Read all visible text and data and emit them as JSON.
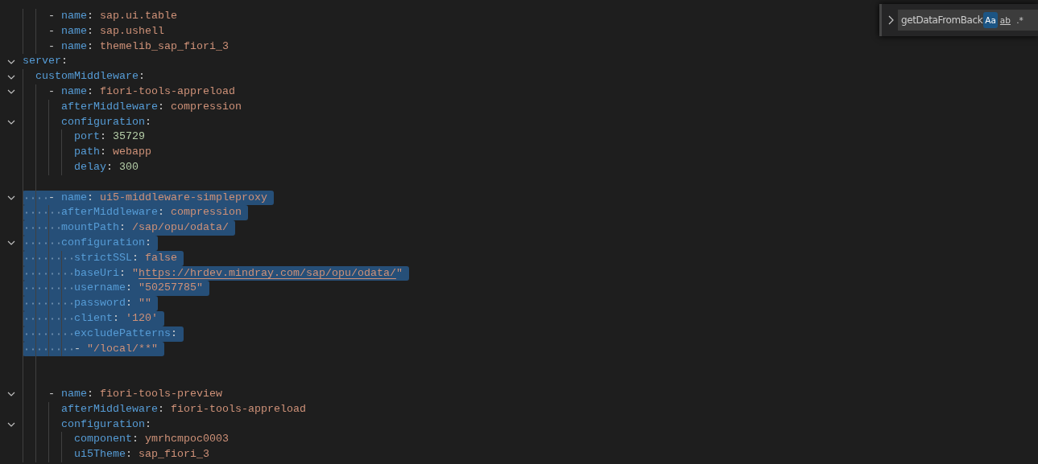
{
  "editor": {
    "lines": [
      {
        "children": [
          {
            "children": [
              {
                "tokens": [
                  {
                    "kind": "dash",
                    "text": "- "
                  },
                  {
                    "kind": "key",
                    "text": "name"
                  },
                  {
                    "kind": "punct",
                    "text": ": "
                  },
                  {
                    "kind": "string",
                    "text": "sap.ui.table"
                  }
                ],
                "foldable": false,
                "selected": false
              },
              {
                "tokens": [
                  {
                    "kind": "dash",
                    "text": "- "
                  },
                  {
                    "kind": "key",
                    "text": "name"
                  },
                  {
                    "kind": "punct",
                    "text": ": "
                  },
                  {
                    "kind": "string",
                    "text": "sap.ushell"
                  }
                ],
                "foldable": false,
                "selected": false
              },
              {
                "tokens": [
                  {
                    "kind": "dash",
                    "text": "- "
                  },
                  {
                    "kind": "key",
                    "text": "name"
                  },
                  {
                    "kind": "punct",
                    "text": ": "
                  },
                  {
                    "kind": "string",
                    "text": "themelib_sap_fiori_3"
                  }
                ],
                "foldable": false,
                "selected": false
              }
            ]
          }
        ]
      },
      {
        "tokens": [
          {
            "kind": "key",
            "text": "server"
          },
          {
            "kind": "punct",
            "text": ":"
          }
        ],
        "foldable": true,
        "selected": false,
        "children": [
          {
            "tokens": [
              {
                "kind": "key",
                "text": "customMiddleware"
              },
              {
                "kind": "punct",
                "text": ":"
              }
            ],
            "foldable": true,
            "selected": false,
            "children": [
              {
                "tokens": [
                  {
                    "kind": "dash",
                    "text": "- "
                  },
                  {
                    "kind": "key",
                    "text": "name"
                  },
                  {
                    "kind": "punct",
                    "text": ": "
                  },
                  {
                    "kind": "string",
                    "text": "fiori-tools-appreload"
                  }
                ],
                "foldable": true,
                "selected": false,
                "children": [
                  {
                    "tokens": [
                      {
                        "kind": "key",
                        "text": "afterMiddleware"
                      },
                      {
                        "kind": "punct",
                        "text": ": "
                      },
                      {
                        "kind": "string",
                        "text": "compression"
                      }
                    ],
                    "foldable": false,
                    "selected": false
                  },
                  {
                    "tokens": [
                      {
                        "kind": "key",
                        "text": "configuration"
                      },
                      {
                        "kind": "punct",
                        "text": ":"
                      }
                    ],
                    "foldable": true,
                    "selected": false,
                    "children": [
                      {
                        "tokens": [
                          {
                            "kind": "key",
                            "text": "port"
                          },
                          {
                            "kind": "punct",
                            "text": ": "
                          },
                          {
                            "kind": "number",
                            "text": "35729"
                          }
                        ],
                        "foldable": false,
                        "selected": false
                      },
                      {
                        "tokens": [
                          {
                            "kind": "key",
                            "text": "path"
                          },
                          {
                            "kind": "punct",
                            "text": ": "
                          },
                          {
                            "kind": "string",
                            "text": "webapp"
                          }
                        ],
                        "foldable": false,
                        "selected": false
                      },
                      {
                        "tokens": [
                          {
                            "kind": "key",
                            "text": "delay"
                          },
                          {
                            "kind": "punct",
                            "text": ": "
                          },
                          {
                            "kind": "number",
                            "text": "300"
                          }
                        ],
                        "foldable": false,
                        "selected": false
                      }
                    ]
                  }
                ]
              },
              {
                "kind": "blank",
                "selected": false
              },
              {
                "tokens": [
                  {
                    "kind": "dash",
                    "text": "- "
                  },
                  {
                    "kind": "key",
                    "text": "name"
                  },
                  {
                    "kind": "punct",
                    "text": ": "
                  },
                  {
                    "kind": "string",
                    "text": "ui5-middleware-simpleproxy"
                  }
                ],
                "foldable": true,
                "selected": true,
                "children": [
                  {
                    "tokens": [
                      {
                        "kind": "key",
                        "text": "afterMiddleware"
                      },
                      {
                        "kind": "punct",
                        "text": ": "
                      },
                      {
                        "kind": "string",
                        "text": "compression"
                      }
                    ],
                    "foldable": false,
                    "selected": true
                  },
                  {
                    "tokens": [
                      {
                        "kind": "key",
                        "text": "mountPath"
                      },
                      {
                        "kind": "punct",
                        "text": ": "
                      },
                      {
                        "kind": "string",
                        "text": "/sap/opu/odata/"
                      }
                    ],
                    "foldable": false,
                    "selected": true
                  },
                  {
                    "tokens": [
                      {
                        "kind": "key",
                        "text": "configuration"
                      },
                      {
                        "kind": "punct",
                        "text": ":"
                      }
                    ],
                    "foldable": true,
                    "selected": true,
                    "children": [
                      {
                        "tokens": [
                          {
                            "kind": "key",
                            "text": "strictSSL"
                          },
                          {
                            "kind": "punct",
                            "text": ": "
                          },
                          {
                            "kind": "string",
                            "text": "false"
                          }
                        ],
                        "foldable": false,
                        "selected": true
                      },
                      {
                        "tokens": [
                          {
                            "kind": "key",
                            "text": "baseUri"
                          },
                          {
                            "kind": "punct",
                            "text": ": "
                          },
                          {
                            "kind": "string",
                            "text": "\""
                          },
                          {
                            "kind": "link",
                            "text": "https://hrdev.mindray.com/sap/opu/odata/"
                          },
                          {
                            "kind": "string",
                            "text": "\""
                          }
                        ],
                        "foldable": false,
                        "selected": true
                      },
                      {
                        "tokens": [
                          {
                            "kind": "key",
                            "text": "username"
                          },
                          {
                            "kind": "punct",
                            "text": ": "
                          },
                          {
                            "kind": "string",
                            "text": "\"50257785\""
                          }
                        ],
                        "foldable": false,
                        "selected": true
                      },
                      {
                        "tokens": [
                          {
                            "kind": "key",
                            "text": "password"
                          },
                          {
                            "kind": "punct",
                            "text": ": "
                          },
                          {
                            "kind": "string",
                            "text": "\"\""
                          }
                        ],
                        "foldable": false,
                        "selected": true
                      },
                      {
                        "tokens": [
                          {
                            "kind": "key",
                            "text": "client"
                          },
                          {
                            "kind": "punct",
                            "text": ": "
                          },
                          {
                            "kind": "string",
                            "text": "'120'"
                          }
                        ],
                        "foldable": false,
                        "selected": true
                      },
                      {
                        "tokens": [
                          {
                            "kind": "key",
                            "text": "excludePatterns"
                          },
                          {
                            "kind": "punct",
                            "text": ":"
                          }
                        ],
                        "foldable": false,
                        "selected": true
                      },
                      {
                        "tokens": [
                          {
                            "kind": "dash",
                            "text": "- "
                          },
                          {
                            "kind": "string",
                            "text": "\"/local/**\""
                          }
                        ],
                        "foldable": false,
                        "selected": true
                      }
                    ]
                  }
                ]
              },
              {
                "kind": "blank",
                "selected": false
              },
              {
                "kind": "blank",
                "selected": false
              },
              {
                "tokens": [
                  {
                    "kind": "dash",
                    "text": "- "
                  },
                  {
                    "kind": "key",
                    "text": "name"
                  },
                  {
                    "kind": "punct",
                    "text": ": "
                  },
                  {
                    "kind": "string",
                    "text": "fiori-tools-preview"
                  }
                ],
                "foldable": true,
                "selected": false,
                "children": [
                  {
                    "tokens": [
                      {
                        "kind": "key",
                        "text": "afterMiddleware"
                      },
                      {
                        "kind": "punct",
                        "text": ": "
                      },
                      {
                        "kind": "string",
                        "text": "fiori-tools-appreload"
                      }
                    ],
                    "foldable": false,
                    "selected": false
                  },
                  {
                    "tokens": [
                      {
                        "kind": "key",
                        "text": "configuration"
                      },
                      {
                        "kind": "punct",
                        "text": ":"
                      }
                    ],
                    "foldable": true,
                    "selected": false,
                    "children": [
                      {
                        "tokens": [
                          {
                            "kind": "key",
                            "text": "component"
                          },
                          {
                            "kind": "punct",
                            "text": ": "
                          },
                          {
                            "kind": "string",
                            "text": "ymrhcmpoc0003"
                          }
                        ],
                        "foldable": false,
                        "selected": false
                      },
                      {
                        "tokens": [
                          {
                            "kind": "key",
                            "text": "ui5Theme"
                          },
                          {
                            "kind": "punct",
                            "text": ": "
                          },
                          {
                            "kind": "string",
                            "text": "sap_fiori_3"
                          }
                        ],
                        "foldable": false,
                        "selected": false
                      }
                    ]
                  }
                ]
              }
            ]
          }
        ]
      }
    ]
  },
  "find_widget": {
    "value": "getDataFromBack",
    "options": [
      {
        "label": "Aa",
        "selected": true
      },
      {
        "label": "ab",
        "selected": false
      },
      {
        "label": ".*",
        "selected": false
      }
    ]
  }
}
